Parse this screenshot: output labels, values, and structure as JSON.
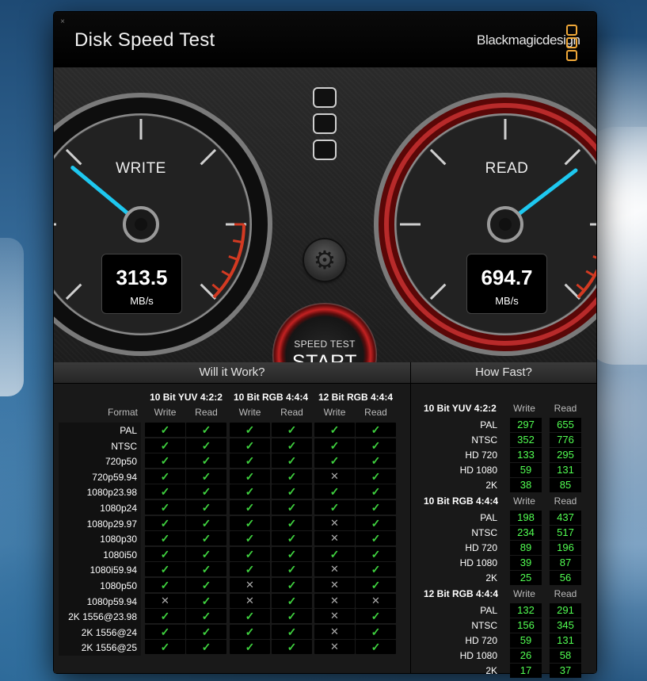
{
  "window": {
    "title": "Disk Speed Test",
    "brand": "Blackmagicdesign",
    "close_glyph": "×"
  },
  "colors": {
    "needle": "#1ec8f0",
    "redline": "#d33a22",
    "brand_accent": "#f0a838",
    "check_green": "#3fd23f",
    "value_green": "#52ff52"
  },
  "write_gauge": {
    "label": "WRITE",
    "value": "313.5",
    "unit": "MB/s"
  },
  "read_gauge": {
    "label": "READ",
    "value": "694.7",
    "unit": "MB/s"
  },
  "controls": {
    "settings_icon": "gear-icon",
    "start_small": "SPEED TEST",
    "start_big": "START"
  },
  "will_it_work": {
    "title": "Will it Work?",
    "format_label": "Format",
    "groups": [
      "10 Bit YUV 4:2:2",
      "10 Bit RGB 4:4:4",
      "12 Bit RGB 4:4:4"
    ],
    "sub_headers": [
      "Write",
      "Read",
      "Write",
      "Read",
      "Write",
      "Read"
    ],
    "rows": [
      {
        "format": "PAL",
        "marks": [
          1,
          1,
          1,
          1,
          1,
          1
        ]
      },
      {
        "format": "NTSC",
        "marks": [
          1,
          1,
          1,
          1,
          1,
          1
        ]
      },
      {
        "format": "720p50",
        "marks": [
          1,
          1,
          1,
          1,
          1,
          1
        ]
      },
      {
        "format": "720p59.94",
        "marks": [
          1,
          1,
          1,
          1,
          0,
          1
        ]
      },
      {
        "format": "1080p23.98",
        "marks": [
          1,
          1,
          1,
          1,
          1,
          1
        ]
      },
      {
        "format": "1080p24",
        "marks": [
          1,
          1,
          1,
          1,
          1,
          1
        ]
      },
      {
        "format": "1080p29.97",
        "marks": [
          1,
          1,
          1,
          1,
          0,
          1
        ]
      },
      {
        "format": "1080p30",
        "marks": [
          1,
          1,
          1,
          1,
          0,
          1
        ]
      },
      {
        "format": "1080i50",
        "marks": [
          1,
          1,
          1,
          1,
          1,
          1
        ]
      },
      {
        "format": "1080i59.94",
        "marks": [
          1,
          1,
          1,
          1,
          0,
          1
        ]
      },
      {
        "format": "1080p50",
        "marks": [
          1,
          1,
          0,
          1,
          0,
          1
        ]
      },
      {
        "format": "1080p59.94",
        "marks": [
          0,
          1,
          0,
          1,
          0,
          0
        ]
      },
      {
        "format": "2K 1556@23.98",
        "marks": [
          1,
          1,
          1,
          1,
          0,
          1
        ]
      },
      {
        "format": "2K 1556@24",
        "marks": [
          1,
          1,
          1,
          1,
          0,
          1
        ]
      },
      {
        "format": "2K 1556@25",
        "marks": [
          1,
          1,
          1,
          1,
          0,
          1
        ]
      }
    ]
  },
  "how_fast": {
    "title": "How Fast?",
    "write_header": "Write",
    "read_header": "Read",
    "groups": [
      {
        "name": "10 Bit YUV 4:2:2",
        "rows": [
          {
            "format": "PAL",
            "write": "297",
            "read": "655"
          },
          {
            "format": "NTSC",
            "write": "352",
            "read": "776"
          },
          {
            "format": "HD 720",
            "write": "133",
            "read": "295"
          },
          {
            "format": "HD 1080",
            "write": "59",
            "read": "131"
          },
          {
            "format": "2K",
            "write": "38",
            "read": "85"
          }
        ]
      },
      {
        "name": "10 Bit RGB 4:4:4",
        "rows": [
          {
            "format": "PAL",
            "write": "198",
            "read": "437"
          },
          {
            "format": "NTSC",
            "write": "234",
            "read": "517"
          },
          {
            "format": "HD 720",
            "write": "89",
            "read": "196"
          },
          {
            "format": "HD 1080",
            "write": "39",
            "read": "87"
          },
          {
            "format": "2K",
            "write": "25",
            "read": "56"
          }
        ]
      },
      {
        "name": "12 Bit RGB 4:4:4",
        "rows": [
          {
            "format": "PAL",
            "write": "132",
            "read": "291"
          },
          {
            "format": "NTSC",
            "write": "156",
            "read": "345"
          },
          {
            "format": "HD 720",
            "write": "59",
            "read": "131"
          },
          {
            "format": "HD 1080",
            "write": "26",
            "read": "58"
          },
          {
            "format": "2K",
            "write": "17",
            "read": "37"
          }
        ]
      }
    ]
  }
}
